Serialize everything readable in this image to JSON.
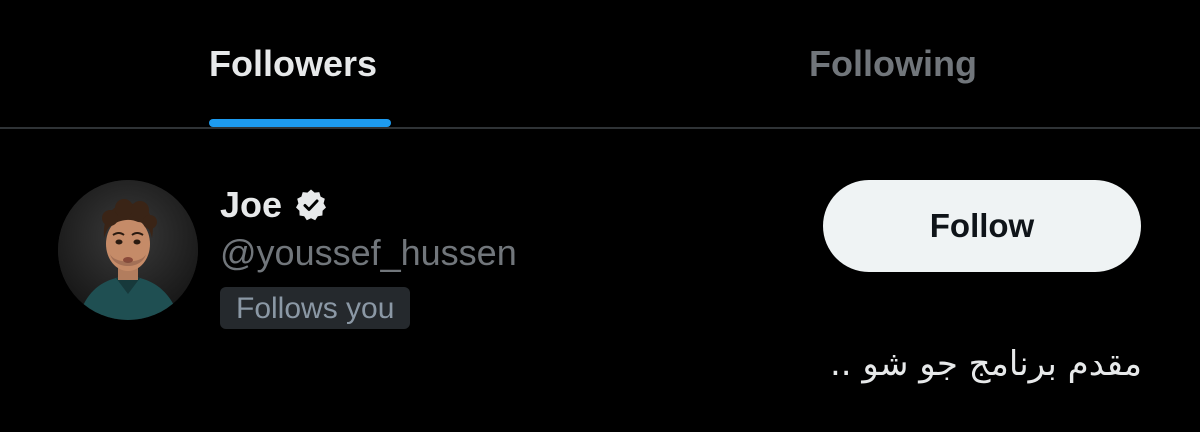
{
  "tabs": [
    {
      "label": "Followers",
      "active": true
    },
    {
      "label": "Following",
      "active": false
    }
  ],
  "user": {
    "display_name": "Joe",
    "verified_icon": "verified-badge-icon",
    "handle": "@youssef_hussen",
    "follows_you_label": "Follows you",
    "follow_button_label": "Follow",
    "bio": "مقدم برنامج جو شو .."
  },
  "colors": {
    "background": "#000000",
    "accent": "#1d9bf0",
    "primary_text": "#e7e9ea",
    "secondary_text": "#71767b",
    "button_bg": "#eff3f4",
    "button_text": "#0f1419",
    "badge_bg": "#25292d"
  }
}
